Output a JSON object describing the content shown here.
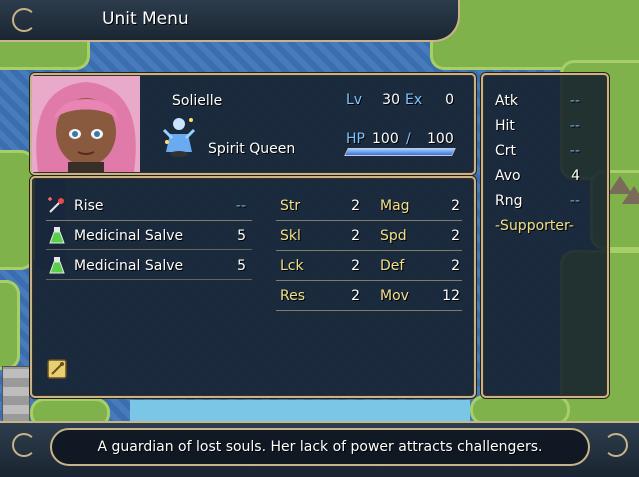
{
  "window": {
    "title": "Unit Menu"
  },
  "unit": {
    "name": "Solielle",
    "class_name": "Spirit Queen",
    "lv_label": "Lv",
    "lv": "30",
    "ex_label": "Ex",
    "ex": "0",
    "hp_label": "HP",
    "hp_current": "100",
    "hp_sep": "/",
    "hp_max": "100",
    "hp_fraction": 1.0
  },
  "items": [
    {
      "icon": "staff-icon",
      "name": "Rise",
      "uses": "--"
    },
    {
      "icon": "potion-icon",
      "name": "Medicinal Salve",
      "uses": "5"
    },
    {
      "icon": "potion-icon",
      "name": "Medicinal Salve",
      "uses": "5"
    }
  ],
  "stats": [
    {
      "label": "Str",
      "value": "2"
    },
    {
      "label": "Mag",
      "value": "2"
    },
    {
      "label": "Skl",
      "value": "2"
    },
    {
      "label": "Spd",
      "value": "2"
    },
    {
      "label": "Lck",
      "value": "2"
    },
    {
      "label": "Def",
      "value": "2"
    },
    {
      "label": "Res",
      "value": "2"
    },
    {
      "label": "Mov",
      "value": "12"
    }
  ],
  "combat": {
    "atk_label": "Atk",
    "atk": "--",
    "hit_label": "Hit",
    "hit": "--",
    "crt_label": "Crt",
    "crt": "--",
    "avo_label": "Avo",
    "avo": "4",
    "rng_label": "Rng",
    "rng": "--",
    "role": "-Supporter-"
  },
  "description": "A guardian of lost souls. Her lack of power attracts challengers.",
  "colors": {
    "frame": "#c8b48a",
    "panel": "#16202c",
    "stat_label": "#f0e08a",
    "number_blue": "#7ec4ff"
  }
}
